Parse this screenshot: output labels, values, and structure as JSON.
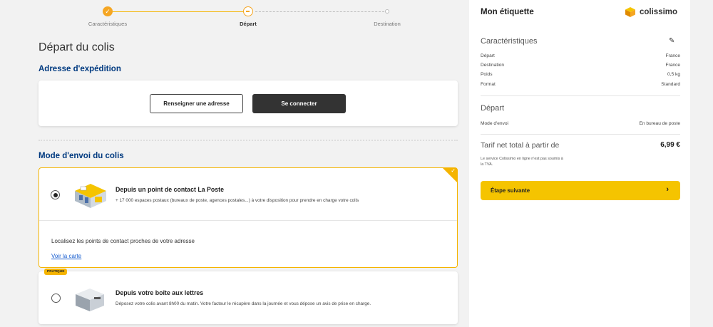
{
  "stepper": {
    "steps": [
      {
        "label": "Caractéristiques",
        "state": "done"
      },
      {
        "label": "Départ",
        "state": "current"
      },
      {
        "label": "Destination",
        "state": "todo"
      }
    ],
    "check_glyph": "✓"
  },
  "page_title": "Départ du colis",
  "address_section": {
    "title": "Adresse d'expédition",
    "enter_address_label": "Renseigner une adresse",
    "login_label": "Se connecter"
  },
  "mode_section": {
    "title": "Mode d'envoi du colis",
    "options": [
      {
        "title": "Depuis un point de contact La Poste",
        "description": "+ 17 000 espaces postaux (bureaux de poste, agences postales...) à votre disposition pour prendre en charge votre colis",
        "selected": true,
        "locate_text": "Localisez les points de contact proches de votre adresse",
        "map_link": "Voir la carte"
      },
      {
        "badge": "PRATIQUE",
        "title": "Depuis votre boîte aux lettres",
        "description": "Déposez votre colis avant 8h00 du matin. Votre facteur le récupère dans la journée et vous dépose un avis de prise en charge.",
        "selected": false
      }
    ]
  },
  "summary": {
    "title": "Mon étiquette",
    "brand": "colissimo",
    "characteristics_title": "Caractéristiques",
    "characteristics": [
      {
        "label": "Départ",
        "value": "France"
      },
      {
        "label": "Destination",
        "value": "France"
      },
      {
        "label": "Poids",
        "value": "0,5 kg"
      },
      {
        "label": "Format",
        "value": "Standard"
      }
    ],
    "departure_title": "Départ",
    "departure": [
      {
        "label": "Mode d'envoi",
        "value": "En bureau de poste"
      }
    ],
    "price_label": "Tarif net total à partir de",
    "price": "6,99 €",
    "vat_note": "Le service Colissimo en ligne n'est pas soumis à la TVA.",
    "next_label": "Étape suivante"
  },
  "colors": {
    "accent": "#f5b400",
    "heading_blue": "#003a80",
    "dark_button": "#333333",
    "link": "#1a5fd0"
  },
  "icons": [
    "check-icon",
    "pencil-icon",
    "chevron-right-icon",
    "colissimo-logo-icon",
    "post-office-illustration",
    "letterbox-illustration"
  ]
}
